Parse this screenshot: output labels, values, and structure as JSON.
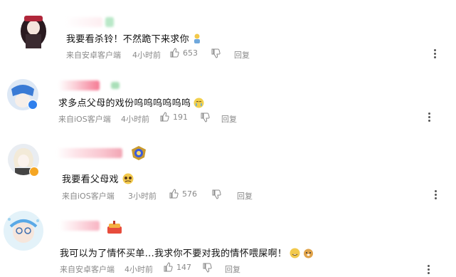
{
  "comments": [
    {
      "text": "我要看杀铃！不然跪下来求你",
      "source": "来自安卓客户端",
      "time": "4小时前",
      "likes": "653",
      "reply": "回复"
    },
    {
      "text": "求多点父母的戏份呜呜呜呜呜呜",
      "source": "来自iOS客户端",
      "time": "4小时前",
      "likes": "191",
      "reply": "回复"
    },
    {
      "text": "我要看父母戏",
      "source": "来自iOS客户端",
      "time": "3小时前",
      "likes": "576",
      "reply": "回复"
    },
    {
      "text": "我可以为了情怀买单...我求你不要对我的情怀喂屎啊！",
      "source": "来自安卓客户端",
      "time": "4小时前",
      "likes": "147",
      "reply": "回复"
    }
  ],
  "colors": {
    "meta": "#8a8a8a",
    "text": "#111111",
    "verified_blue": "#2f80ed",
    "verified_orange": "#f5a623"
  }
}
